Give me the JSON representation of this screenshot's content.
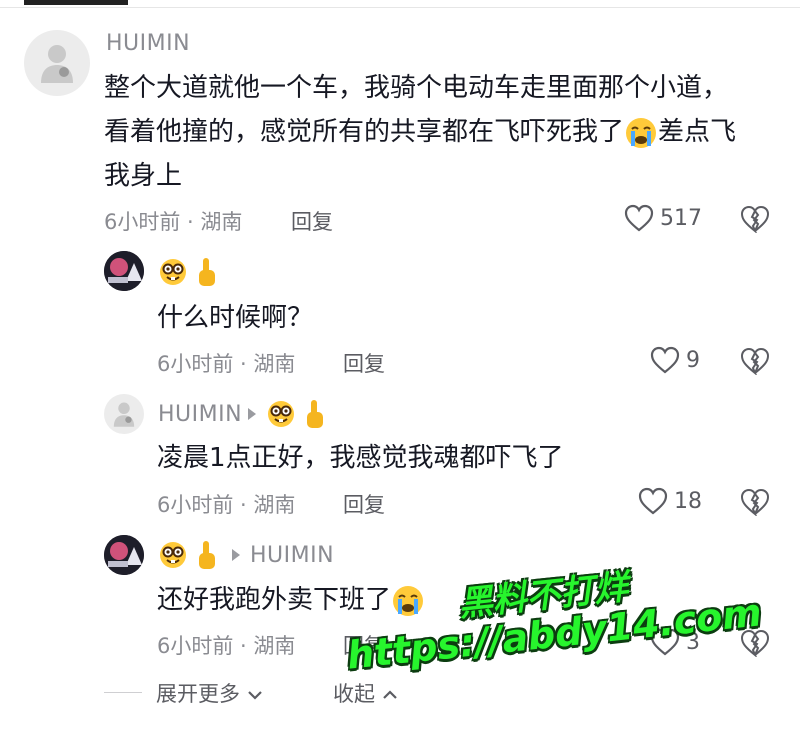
{
  "main_comment": {
    "username": "HUIMIN",
    "text_lines": [
      "整个大道就他一个车，我骑个电动车走里面那个小道，",
      "看着他撞的，感觉所有的共享都在飞吓死我了",
      "差点飞",
      "我身上"
    ],
    "time_location": "6小时前 · 湖南",
    "reply_label": "回复",
    "likes": "517"
  },
  "replies": [
    {
      "username_emoji": "nerd-face + pointing-up",
      "text": "什么时候啊？",
      "time_location": "6小时前 · 湖南",
      "reply_label": "回复",
      "likes": "9"
    },
    {
      "username": "HUIMIN",
      "reply_to_emoji": "nerd-face + pointing-up",
      "text": "凌晨1点正好，我感觉我魂都吓飞了",
      "time_location": "6小时前 · 湖南",
      "reply_label": "回复",
      "likes": "18"
    },
    {
      "username_emoji": "nerd-face + pointing-up",
      "reply_to": "HUIMIN",
      "text": "还好我跑外卖下班了",
      "time_location": "6小时前 · 湖南",
      "reply_label": "回复",
      "likes": "3"
    }
  ],
  "footer": {
    "expand_label": "展开更多",
    "collapse_label": "收起"
  },
  "watermark": {
    "line1": "黑料不打烊",
    "line2": "https://abdy14.com"
  },
  "colors": {
    "text_primary": "#161823",
    "text_secondary": "#8a8b91",
    "watermark_green": "#27f52d"
  }
}
